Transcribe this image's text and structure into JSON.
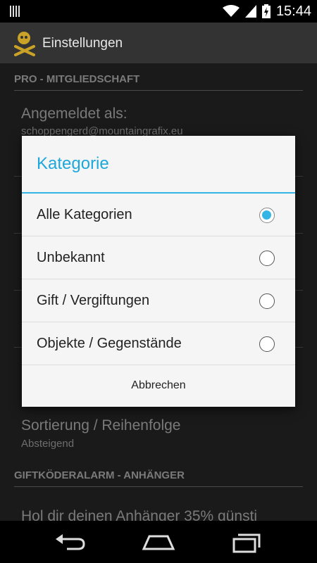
{
  "status_bar": {
    "time": "15:44"
  },
  "action_bar": {
    "title": "Einstellungen"
  },
  "settings": {
    "category_membership": "PRO - MITGLIEDSCHAFT",
    "logged_in": {
      "title": "Angemeldet als:",
      "summary": "schoppengerd@mountaingrafix.eu"
    },
    "sort": {
      "title": "Sortierung / Reihenfolge",
      "summary": "Absteigend"
    },
    "category_alarm": "GIFTKÖDERALARM - ANHÄNGER",
    "pendant": {
      "title": "Hol dir deinen Anhänger 35% günsti"
    }
  },
  "dialog": {
    "title": "Kategorie",
    "options": [
      {
        "label": "Alle Kategorien",
        "checked": true
      },
      {
        "label": "Unbekannt",
        "checked": false
      },
      {
        "label": "Gift / Vergiftungen",
        "checked": false
      },
      {
        "label": "Objekte / Gegenstände",
        "checked": false
      }
    ],
    "cancel_label": "Abbrechen"
  },
  "colors": {
    "accent": "#33b5e5",
    "title_text": "#1ea7da"
  }
}
